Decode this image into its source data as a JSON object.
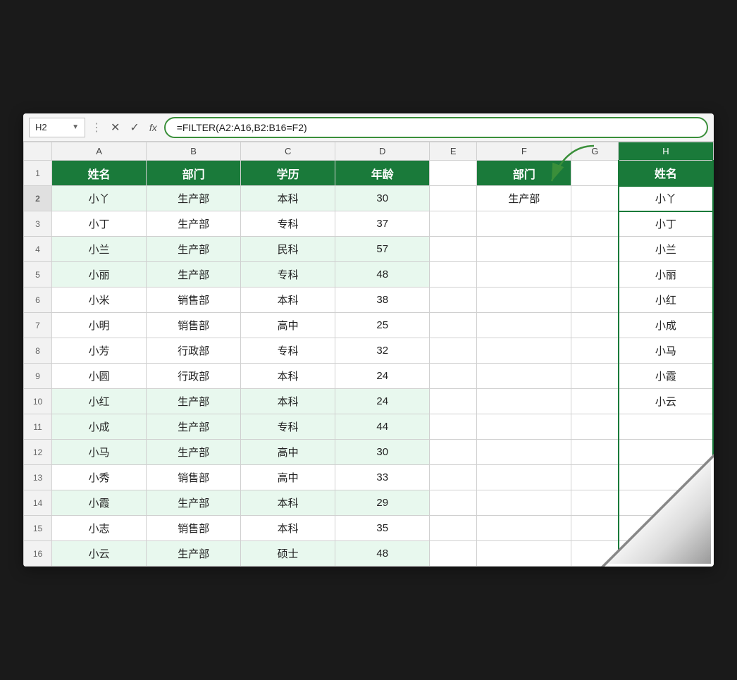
{
  "formulaBar": {
    "cellRef": "H2",
    "dropdownArrow": "▼",
    "cancelIcon": "✕",
    "confirmIcon": "✓",
    "fxLabel": "fx",
    "formula": "=FILTER(A2:A16,B2:B16=F2)"
  },
  "columnHeaders": {
    "corner": "",
    "cols": [
      "A",
      "B",
      "C",
      "D",
      "E",
      "F",
      "G",
      "H"
    ]
  },
  "headers": {
    "row1": [
      "姓名",
      "部门",
      "学历",
      "年龄",
      "",
      "部门",
      "",
      "姓名"
    ]
  },
  "rows": [
    {
      "num": 2,
      "cells": [
        "小丫",
        "生产部",
        "本科",
        "30",
        "",
        "生产部",
        "",
        "小丫"
      ],
      "highlight": true
    },
    {
      "num": 3,
      "cells": [
        "小丁",
        "生产部",
        "专科",
        "37",
        "",
        "",
        "",
        "小丁"
      ],
      "highlight": false
    },
    {
      "num": 4,
      "cells": [
        "小兰",
        "生产部",
        "民科",
        "57",
        "",
        "",
        "",
        "小兰"
      ],
      "highlight": true
    },
    {
      "num": 5,
      "cells": [
        "小丽",
        "生产部",
        "专科",
        "48",
        "",
        "",
        "",
        "小丽"
      ],
      "highlight": true
    },
    {
      "num": 6,
      "cells": [
        "小米",
        "销售部",
        "本科",
        "38",
        "",
        "",
        "",
        "小红"
      ],
      "highlight": false
    },
    {
      "num": 7,
      "cells": [
        "小明",
        "销售部",
        "高中",
        "25",
        "",
        "",
        "",
        "小成"
      ],
      "highlight": false
    },
    {
      "num": 8,
      "cells": [
        "小芳",
        "行政部",
        "专科",
        "32",
        "",
        "",
        "",
        "小马"
      ],
      "highlight": false
    },
    {
      "num": 9,
      "cells": [
        "小圆",
        "行政部",
        "本科",
        "24",
        "",
        "",
        "",
        "小霞"
      ],
      "highlight": false
    },
    {
      "num": 10,
      "cells": [
        "小红",
        "生产部",
        "本科",
        "24",
        "",
        "",
        "",
        "小云"
      ],
      "highlight": true
    },
    {
      "num": 11,
      "cells": [
        "小成",
        "生产部",
        "专科",
        "44",
        "",
        "",
        "",
        ""
      ],
      "highlight": true
    },
    {
      "num": 12,
      "cells": [
        "小马",
        "生产部",
        "高中",
        "30",
        "",
        "",
        "",
        ""
      ],
      "highlight": true
    },
    {
      "num": 13,
      "cells": [
        "小秀",
        "销售部",
        "高中",
        "33",
        "",
        "",
        "",
        ""
      ],
      "highlight": false
    },
    {
      "num": 14,
      "cells": [
        "小霞",
        "生产部",
        "本科",
        "29",
        "",
        "",
        "",
        ""
      ],
      "highlight": true
    },
    {
      "num": 15,
      "cells": [
        "小志",
        "销售部",
        "本科",
        "35",
        "",
        "",
        "",
        ""
      ],
      "highlight": false
    },
    {
      "num": 16,
      "cells": [
        "小云",
        "生产部",
        "硕士",
        "48",
        "",
        "",
        "",
        ""
      ],
      "highlight": true
    }
  ]
}
